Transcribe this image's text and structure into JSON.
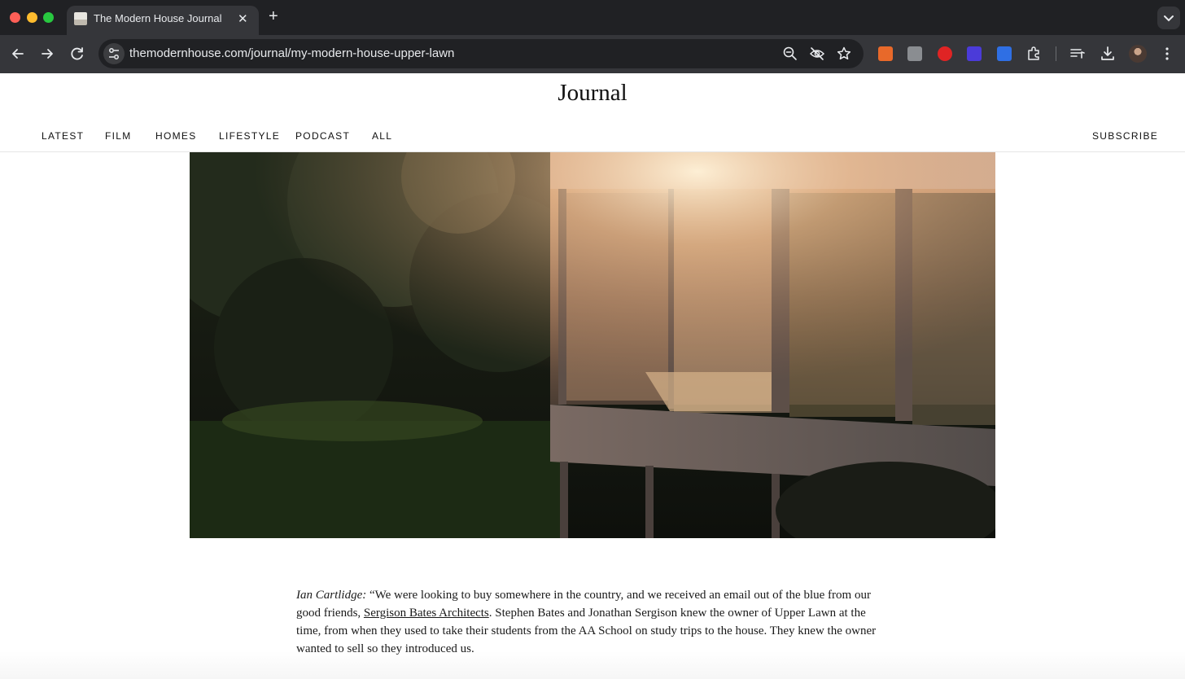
{
  "browser": {
    "tab_title": "The Modern House Journal",
    "url": "themodernhouse.com/journal/my-modern-house-upper-lawn",
    "new_tab_symbol": "+",
    "close_symbol": "✕"
  },
  "site": {
    "brand": "Journal",
    "nav": [
      "LATEST",
      "FILM",
      "HOMES",
      "LIFESTYLE",
      "PODCAST",
      "ALL"
    ],
    "subscribe": "SUBSCRIBE"
  },
  "hero": {
    "icon": "photo-house-glass-facade-at-sunset"
  },
  "article": {
    "speaker": "Ian Cartlidge:",
    "text_1": " “We were looking to buy somewhere in the country, and we received an email out of the blue from our good friends, ",
    "link": "Sergison Bates Architects",
    "text_2": ". Stephen Bates and Jonathan Sergison knew the owner of Upper Lawn at the time, from when they used to take their students from the AA School on study trips to the house. They knew the owner wanted to sell so they introduced us."
  },
  "colors": {
    "chrome_dark": "#202124",
    "chrome_toolbar": "#35363a",
    "text": "#111111"
  }
}
